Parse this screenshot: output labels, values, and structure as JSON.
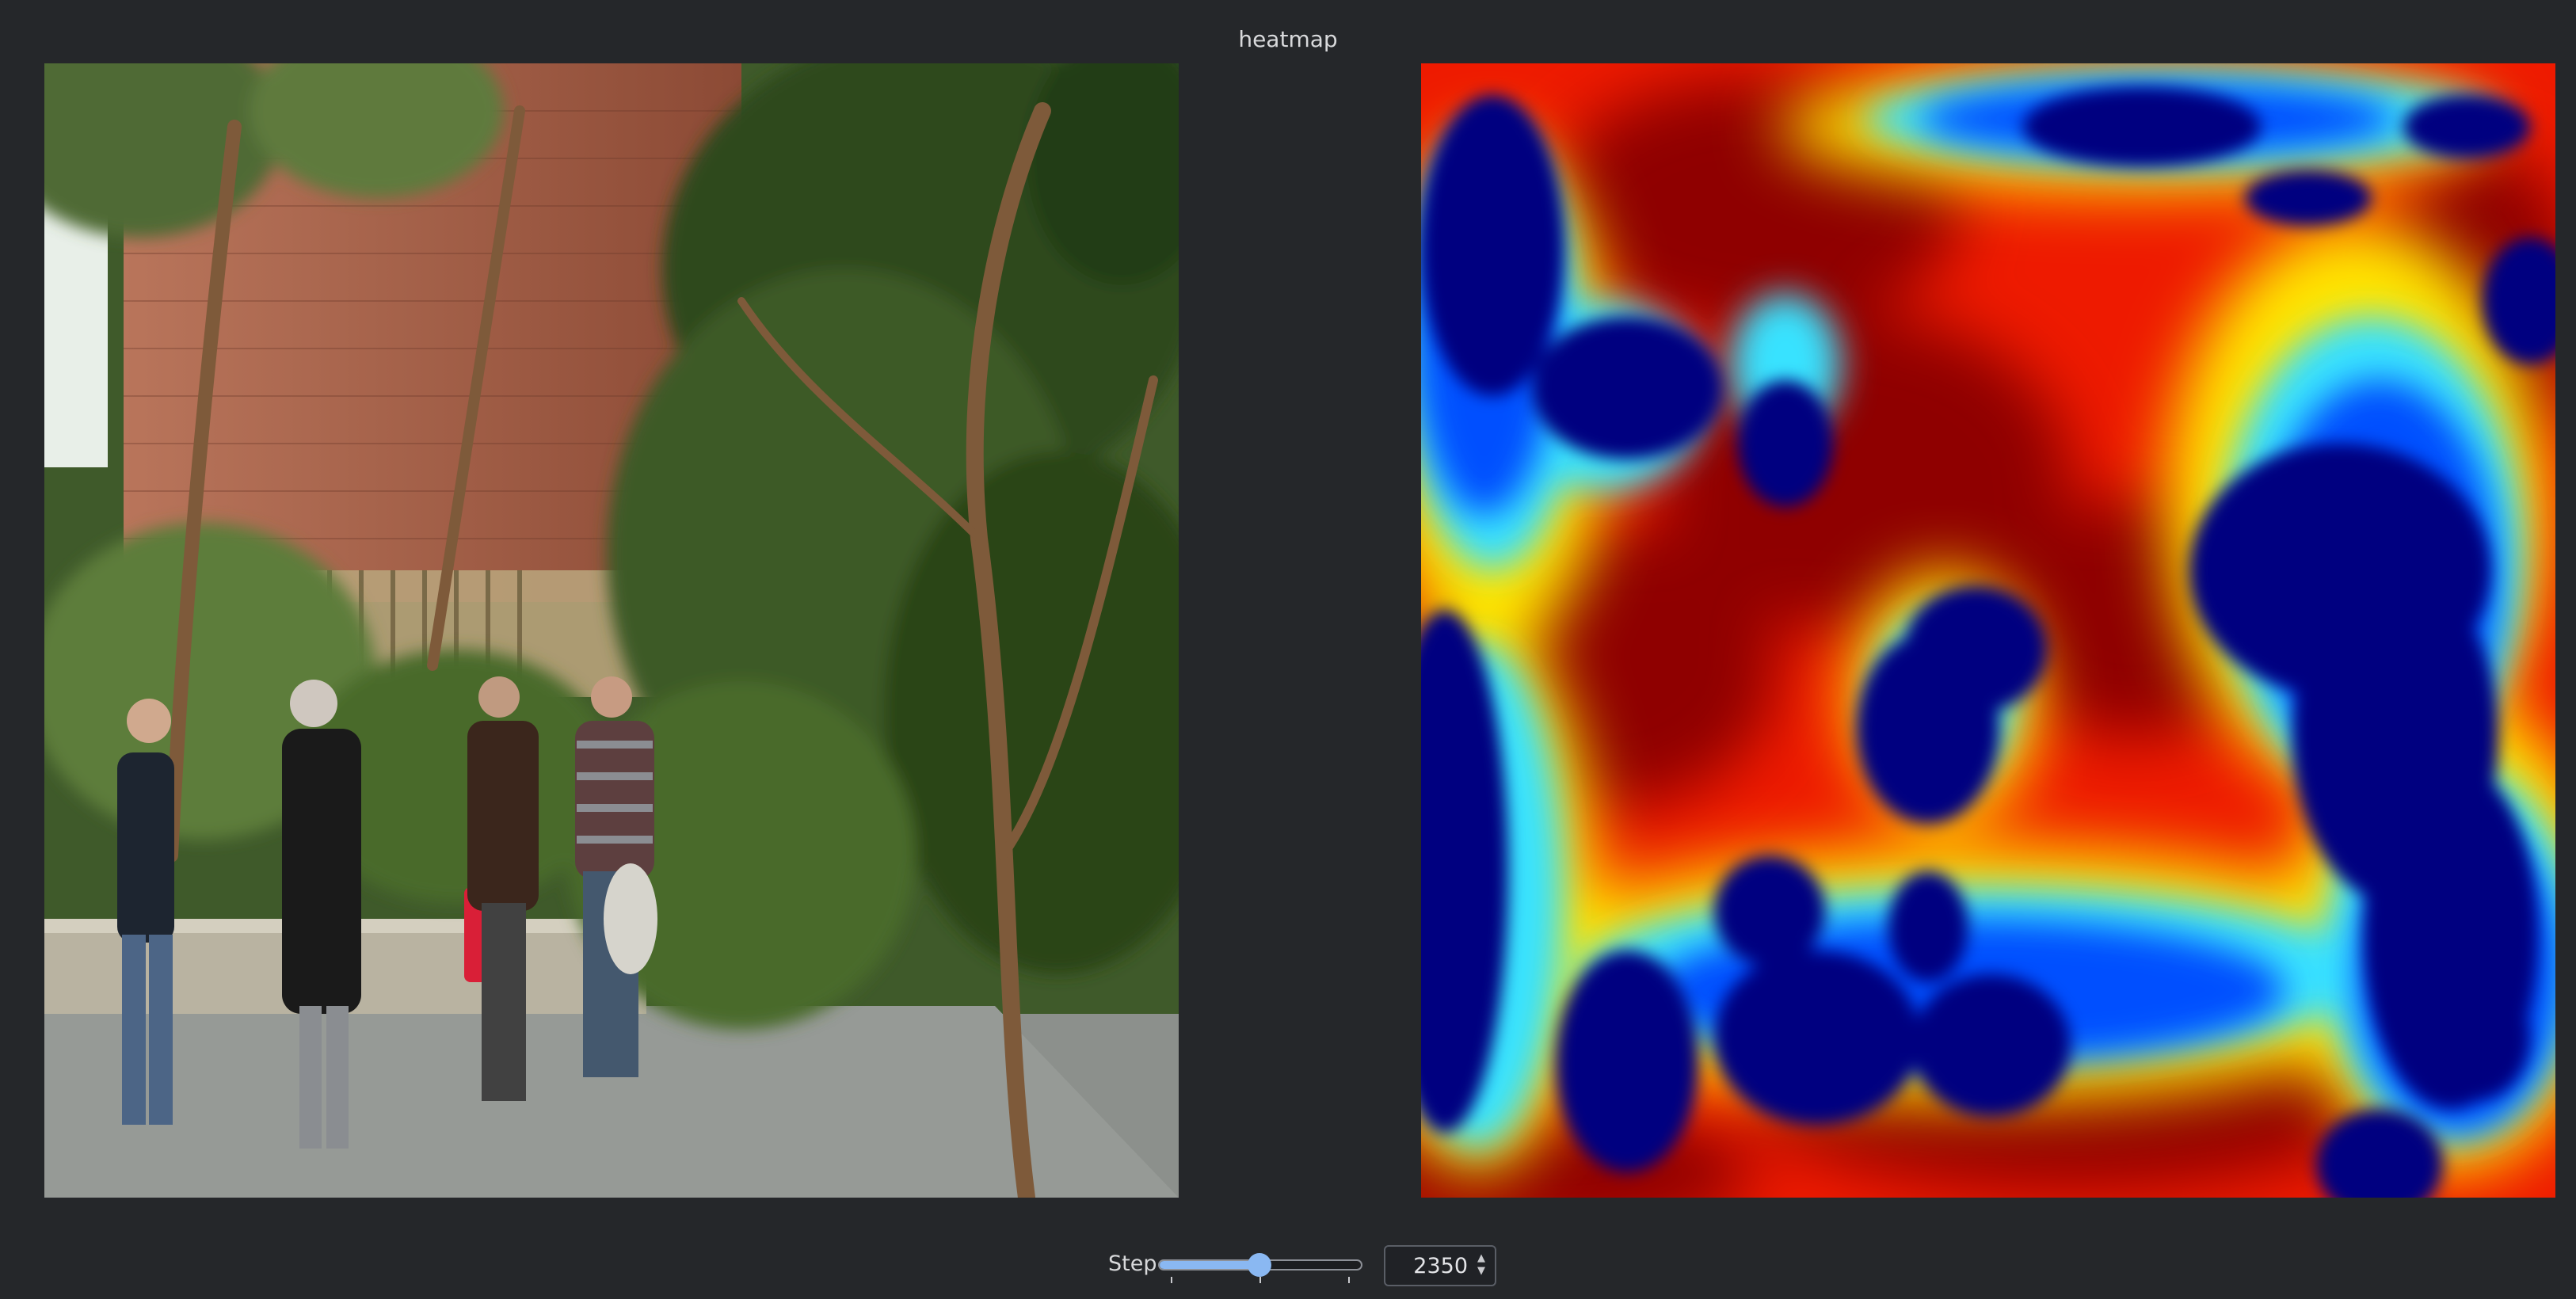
{
  "window": {
    "title": "heatmap"
  },
  "images": {
    "photo_icon": "photo-image",
    "heatmap_icon": "heatmap-image",
    "heatmap_colormap": [
      "#00007f",
      "#0060ff",
      "#00e6ff",
      "#ffff00",
      "#ff4000",
      "#e00000",
      "#8b0000"
    ]
  },
  "controls": {
    "step_label": "Step",
    "step_value": "2350",
    "slider_position": 0.5,
    "accent_color": "#8ab8f2"
  }
}
